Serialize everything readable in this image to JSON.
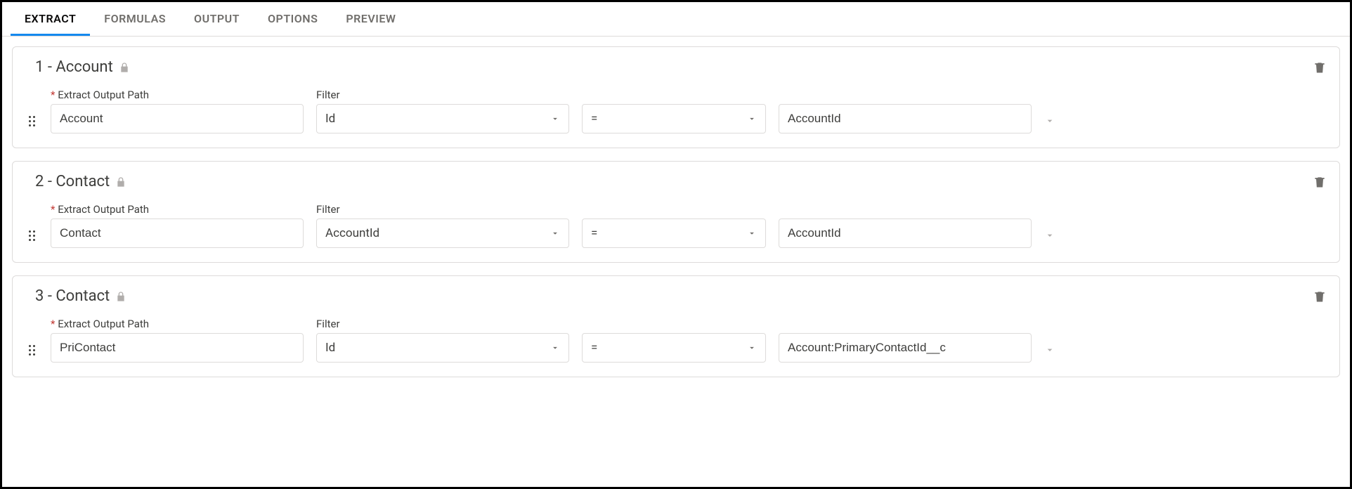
{
  "tabs": [
    {
      "label": "EXTRACT",
      "active": true
    },
    {
      "label": "FORMULAS",
      "active": false
    },
    {
      "label": "OUTPUT",
      "active": false
    },
    {
      "label": "OPTIONS",
      "active": false
    },
    {
      "label": "PREVIEW",
      "active": false
    }
  ],
  "labels": {
    "output_path": "Extract Output Path",
    "filter": "Filter"
  },
  "blocks": [
    {
      "title": "1 - Account",
      "output_path": "Account",
      "filter_field": "Id",
      "operator": "=",
      "filter_value": "AccountId"
    },
    {
      "title": "2 - Contact",
      "output_path": "Contact",
      "filter_field": "AccountId",
      "operator": "=",
      "filter_value": "AccountId"
    },
    {
      "title": "3 - Contact",
      "output_path": "PriContact",
      "filter_field": "Id",
      "operator": "=",
      "filter_value": "Account:PrimaryContactId__c"
    }
  ]
}
